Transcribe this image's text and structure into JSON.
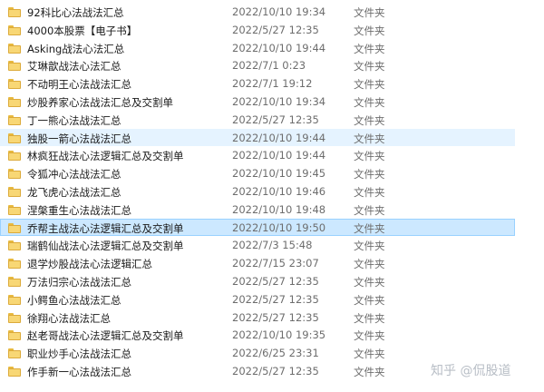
{
  "files": [
    {
      "name": "92科比心法战法汇总",
      "date": "2022/10/10 19:34",
      "type": "文件夹"
    },
    {
      "name": "4000本股票【电子书】",
      "date": "2022/5/27 12:35",
      "type": "文件夹"
    },
    {
      "name": "Asking战法心法汇总",
      "date": "2022/10/10 19:44",
      "type": "文件夹"
    },
    {
      "name": "艾琳歆战法心法汇总",
      "date": "2022/7/1 0:23",
      "type": "文件夹"
    },
    {
      "name": "不动明王心法战法汇总",
      "date": "2022/7/1 19:12",
      "type": "文件夹"
    },
    {
      "name": "炒股养家心法战法汇总及交割单",
      "date": "2022/10/10 19:34",
      "type": "文件夹"
    },
    {
      "name": "丁一熊心法战法汇总",
      "date": "2022/5/27 12:35",
      "type": "文件夹"
    },
    {
      "name": "独股一箭心法战法汇总",
      "date": "2022/10/10 19:44",
      "type": "文件夹"
    },
    {
      "name": "林疯狂战法心法逻辑汇总及交割单",
      "date": "2022/10/10 19:44",
      "type": "文件夹"
    },
    {
      "name": "令狐冲心法战法汇总",
      "date": "2022/10/10 19:45",
      "type": "文件夹"
    },
    {
      "name": "龙飞虎心法战法汇总",
      "date": "2022/10/10 19:46",
      "type": "文件夹"
    },
    {
      "name": "涅槃重生心法战法汇总",
      "date": "2022/10/10 19:48",
      "type": "文件夹"
    },
    {
      "name": "乔帮主战法心法逻辑汇总及交割单",
      "date": "2022/10/10 19:50",
      "type": "文件夹"
    },
    {
      "name": "瑞鹤仙战法心法逻辑汇总及交割单",
      "date": "2022/7/3 15:48",
      "type": "文件夹"
    },
    {
      "name": "退学炒股战法心法逻辑汇总",
      "date": "2022/7/15 23:07",
      "type": "文件夹"
    },
    {
      "name": "万法归宗心法战法汇总",
      "date": "2022/5/27 12:35",
      "type": "文件夹"
    },
    {
      "name": "小鳄鱼心法战法汇总",
      "date": "2022/5/27 12:35",
      "type": "文件夹"
    },
    {
      "name": "徐翔心法战法汇总",
      "date": "2022/5/27 12:35",
      "type": "文件夹"
    },
    {
      "name": "赵老哥战法心法逻辑汇总及交割单",
      "date": "2022/10/10 19:35",
      "type": "文件夹"
    },
    {
      "name": "职业炒手心法战法汇总",
      "date": "2022/6/25 23:31",
      "type": "文件夹"
    },
    {
      "name": "作手新一心法战法汇总",
      "date": "2022/5/27 12:35",
      "type": "文件夹"
    }
  ],
  "hover_row": 7,
  "selected_row": 12,
  "watermark": "知乎 @侃股道"
}
